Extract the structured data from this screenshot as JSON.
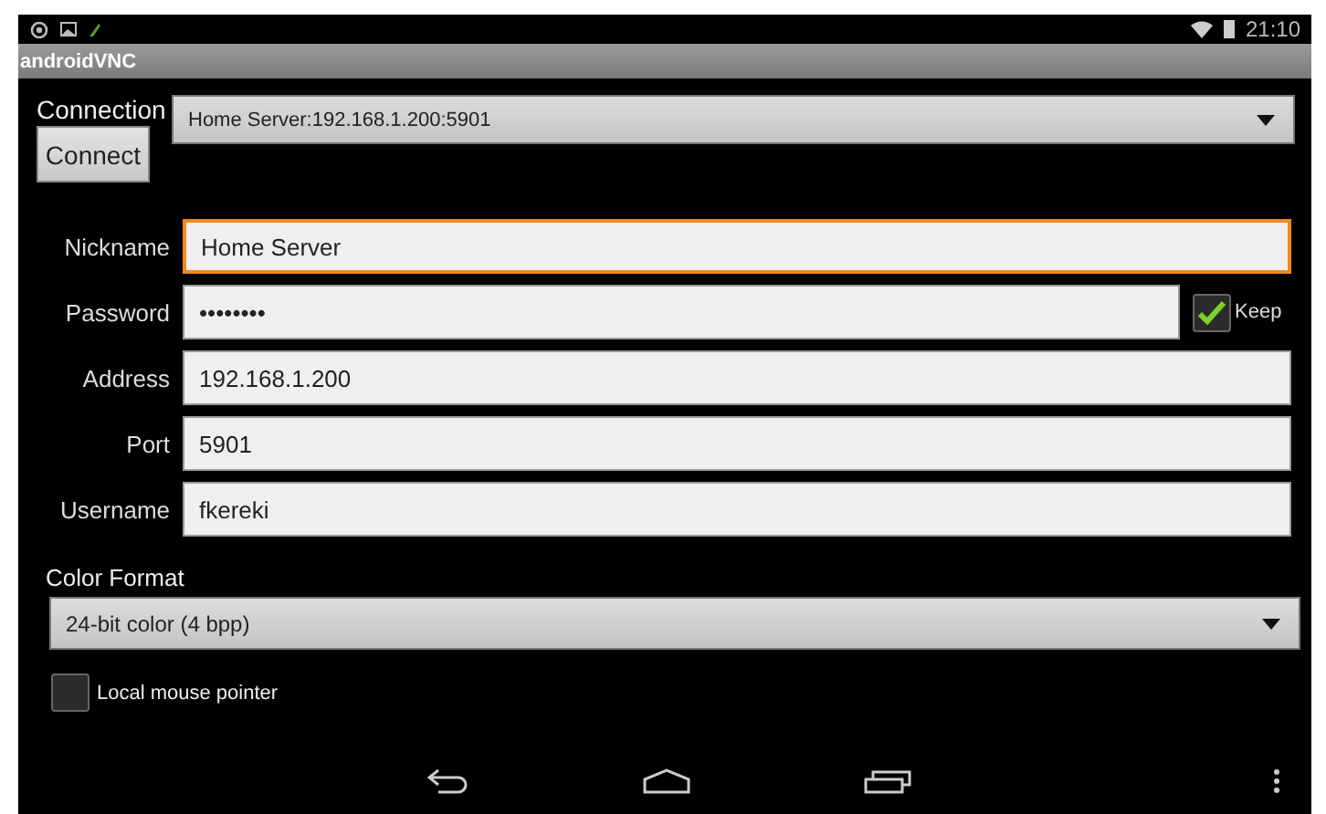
{
  "status_bar": {
    "time": "21:10"
  },
  "window": {
    "title": "androidVNC"
  },
  "connection": {
    "label": "Connection",
    "value": "Home Server:192.168.1.200:5901",
    "button": "Connect"
  },
  "fields": [
    {
      "label": "Nickname",
      "value": "Home Server",
      "focused": true
    },
    {
      "label": "Password",
      "value": "••••••••",
      "focused": false,
      "keep": {
        "label": "Keep",
        "checked": true
      }
    },
    {
      "label": "Address",
      "value": "192.168.1.200",
      "focused": false
    },
    {
      "label": "Port",
      "value": "5901",
      "focused": false
    },
    {
      "label": "Username",
      "value": "fkereki",
      "focused": false
    }
  ],
  "color_format": {
    "label": "Color Format",
    "value": "24-bit color (4 bpp)"
  },
  "options": [
    {
      "label": "Local mouse pointer",
      "checked": false
    }
  ]
}
